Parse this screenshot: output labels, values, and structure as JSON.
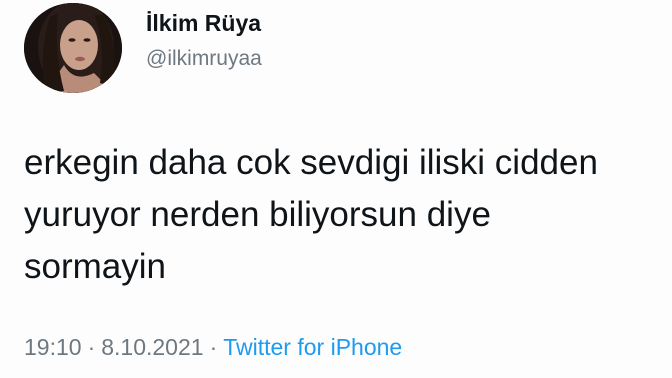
{
  "author": {
    "display_name": "İlkim Rüya",
    "handle": "@ilkimruyaa"
  },
  "tweet": {
    "text": "erkegin daha cok sevdigi iliski cidden\nyuruyor nerden biliyorsun diye\nsormayin"
  },
  "meta": {
    "time": "19:10",
    "separator": "·",
    "date": "8.10.2021",
    "source": "Twitter for iPhone"
  },
  "colors": {
    "text_primary": "#0f1419",
    "text_secondary": "#6e7881",
    "link": "#1d9bf0"
  }
}
